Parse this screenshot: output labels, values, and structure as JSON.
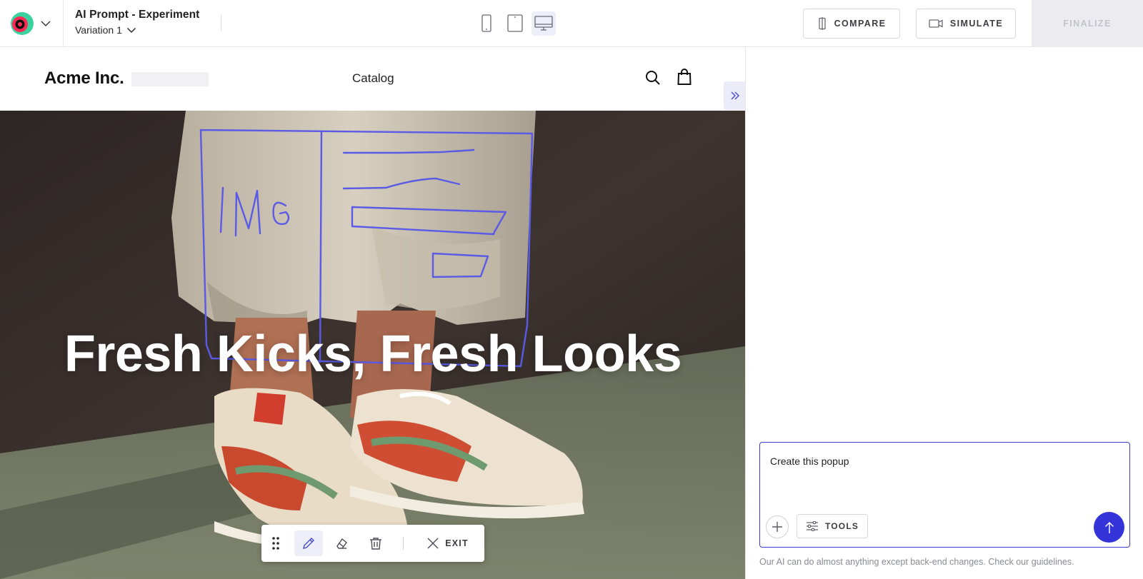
{
  "app": {
    "experiment_title": "AI Prompt - Experiment",
    "variation_label": "Variation 1"
  },
  "toolbar": {
    "compare_label": "COMPARE",
    "simulate_label": "SIMULATE",
    "finalize_label": "FINALIZE",
    "devices": [
      {
        "name": "mobile",
        "icon": "mobile-device-icon",
        "active": false
      },
      {
        "name": "tablet",
        "icon": "tablet-device-icon",
        "active": false
      },
      {
        "name": "desktop",
        "icon": "desktop-device-icon",
        "active": true
      }
    ]
  },
  "site": {
    "brand": "Acme Inc.",
    "nav_items": [
      "Catalog"
    ],
    "hero_title": "Fresh Kicks, Fresh Looks",
    "sketch_text": "IMG"
  },
  "draw_toolbar": {
    "exit_label": "EXIT",
    "tools": [
      "drag-handle",
      "pen",
      "eraser",
      "trash"
    ],
    "active_tool": "pen"
  },
  "ai_panel": {
    "prompt_value": "Create this popup",
    "tools_label": "TOOLS",
    "disclaimer": "Our AI can do almost anything except back-end changes. Check our guidelines."
  },
  "colors": {
    "accent": "#3434d8",
    "sketch_stroke": "#5a5ae6",
    "finalize_bg": "#ebebf0"
  }
}
